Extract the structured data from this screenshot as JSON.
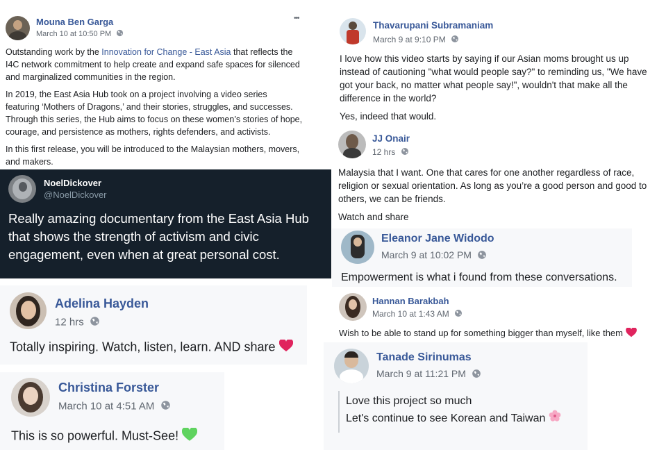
{
  "posts": {
    "mouna": {
      "name": "Mouna Ben Garga",
      "time": "March 10 at 10:50 PM",
      "dots": "•••",
      "p1_before": "Outstanding work by the ",
      "p1_link": "Innovation for Change - East Asia",
      "p1_after": " that reflects the I4C network commitment to help create and expand safe spaces for silenced and marginalized communities in the region.",
      "p2": "In 2019, the East Asia Hub took on a project involving a video series featuring ‘Mothers of Dragons,’ and their stories, struggles, and successes. Through this series, the Hub aims to focus on these women’s stories of hope, courage, and persistence as mothers, rights defenders, and activists.",
      "p3": "In this first release, you will be introduced to the Malaysian mothers, movers, and makers."
    },
    "noel": {
      "name": "NoelDickover",
      "handle": "@NoelDickover",
      "text": "Really amazing documentary from the East Asia Hub that shows the strength of activism and civic engagement, even when at great personal cost."
    },
    "adelina": {
      "name": "Adelina Hayden",
      "time": "12 hrs",
      "text": "Totally inspiring. Watch, listen, learn. AND share"
    },
    "christina": {
      "name": "Christina Forster",
      "time": "March 10 at 4:51 AM",
      "text": "This is so powerful. Must-See!"
    },
    "thavarupani": {
      "name": "Thavarupani Subramaniam",
      "time": "March 9 at 9:10 PM",
      "p1": "I love how this video starts by saying if our Asian moms brought us up instead of cautioning \"what would people say?\" to reminding us, \"We have got your back, no matter what people say!\", wouldn't that make all the difference in the world?",
      "p2": "Yes, indeed that would."
    },
    "jj": {
      "name": "JJ Onair",
      "time": "12 hrs",
      "p1": "Malaysia that I want. One that cares for one another regardless of race, religion or sexual orientation. As long as you’re a good person and good to others, we can be friends.",
      "p2": "Watch and share"
    },
    "eleanor": {
      "name": "Eleanor Jane Widodo",
      "time": "March 9 at 10:02 PM",
      "text": "Empowerment is what i found from these conversations."
    },
    "hannan": {
      "name": "Hannan Barakbah",
      "time": "March 10 at 1:43 AM",
      "text": "Wish to be able to stand up for something bigger than myself, like them"
    },
    "tanade": {
      "name": "Tanade Sirinumas",
      "time": "March 9 at 11:21 PM",
      "line1": "Love this project so much",
      "line2": "Let's continue to see Korean and Taiwan"
    }
  },
  "colors": {
    "facebook_blue": "#385898",
    "meta_grey": "#606770",
    "tweet_bg": "#15202b",
    "heart_red": "#e0245e",
    "heart_green": "#5fd35f"
  },
  "icons": [
    "globe-icon",
    "more-options-icon",
    "red-heart-emoji",
    "green-heart-emoji",
    "cherry-blossom-emoji"
  ]
}
